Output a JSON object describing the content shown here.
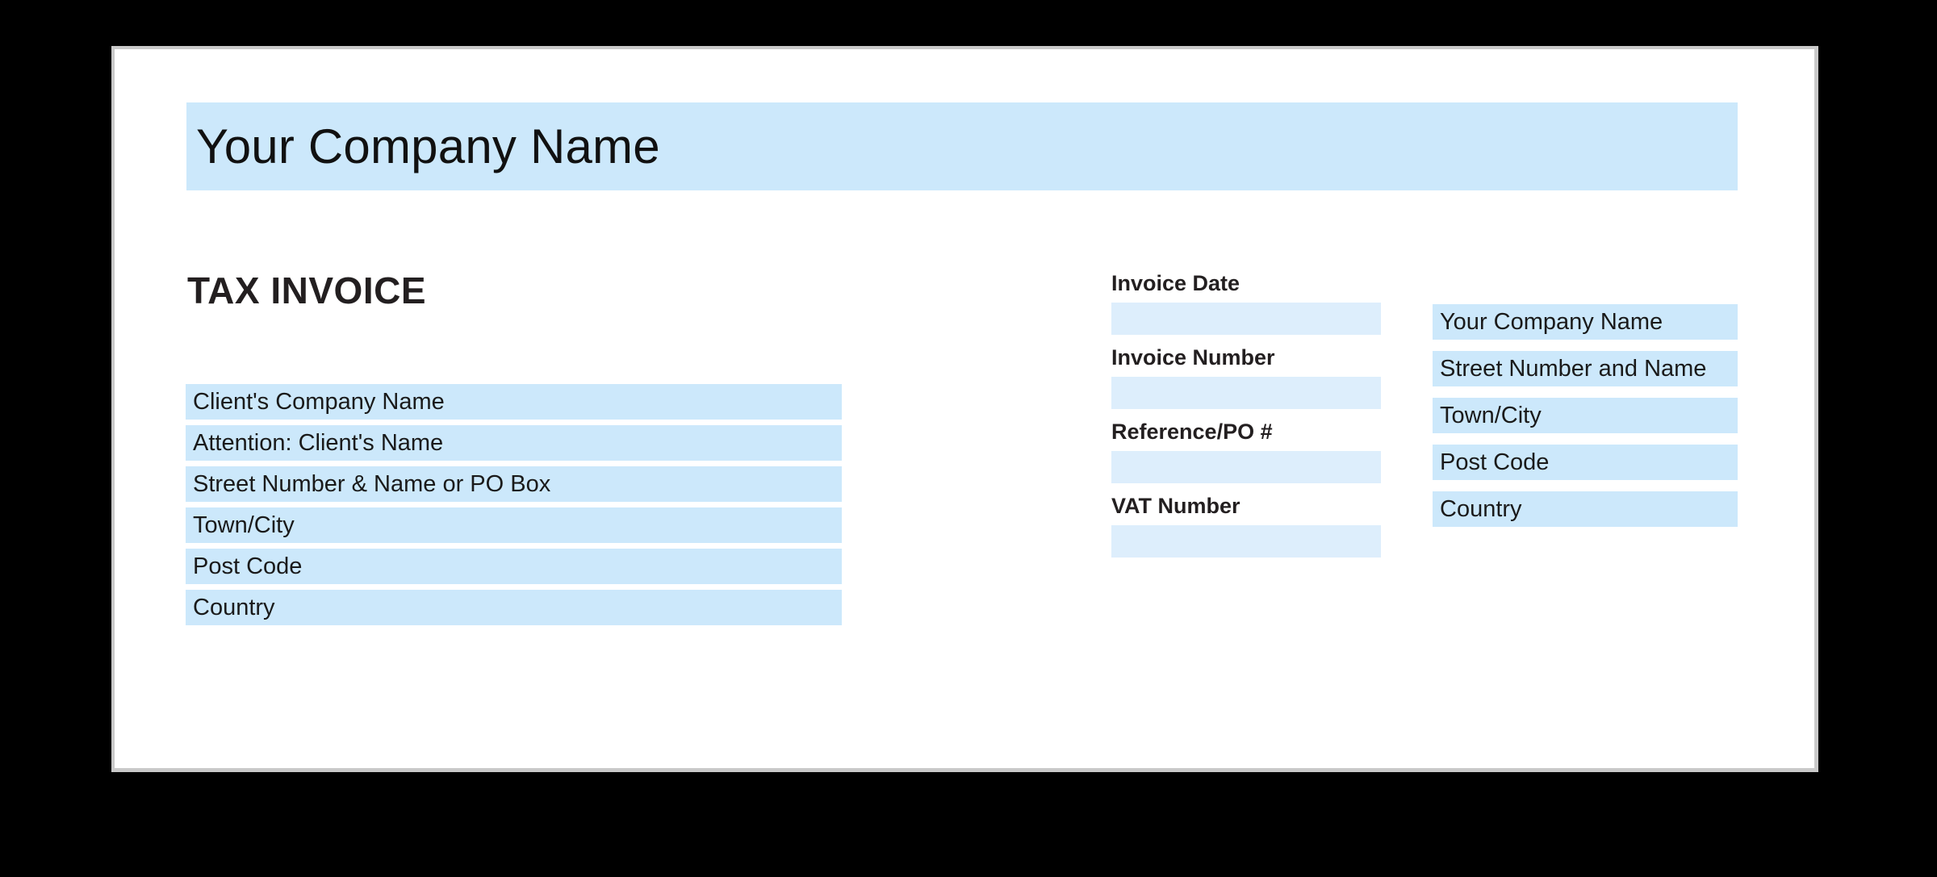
{
  "page": {
    "background_color": "#000000",
    "sheet_color": "#ffffff",
    "sheet_border_color": "#c9c9c9",
    "accent_fill": "#cce8fb",
    "input_fill": "#ddeefc",
    "text_color": "#1a1a1a",
    "heading_color": "#231f20"
  },
  "masthead": {
    "company_name": "Your Company Name"
  },
  "heading": {
    "title": "TAX INVOICE"
  },
  "client_address": {
    "rows": [
      {
        "text": "Client's Company Name"
      },
      {
        "text": "Attention: Client's Name"
      },
      {
        "text": "Street Number & Name or PO Box"
      },
      {
        "text": "Town/City"
      },
      {
        "text": "Post Code"
      },
      {
        "text": "Country"
      }
    ]
  },
  "invoice_details": {
    "fields": [
      {
        "label": "Invoice Date",
        "value": ""
      },
      {
        "label": "Invoice Number",
        "value": ""
      },
      {
        "label": "Reference/PO #",
        "value": ""
      },
      {
        "label": "VAT Number",
        "value": ""
      }
    ]
  },
  "company_address": {
    "rows": [
      {
        "text": "Your Company Name"
      },
      {
        "text": "Street Number and Name"
      },
      {
        "text": "Town/City"
      },
      {
        "text": "Post Code"
      },
      {
        "text": "Country"
      }
    ]
  }
}
